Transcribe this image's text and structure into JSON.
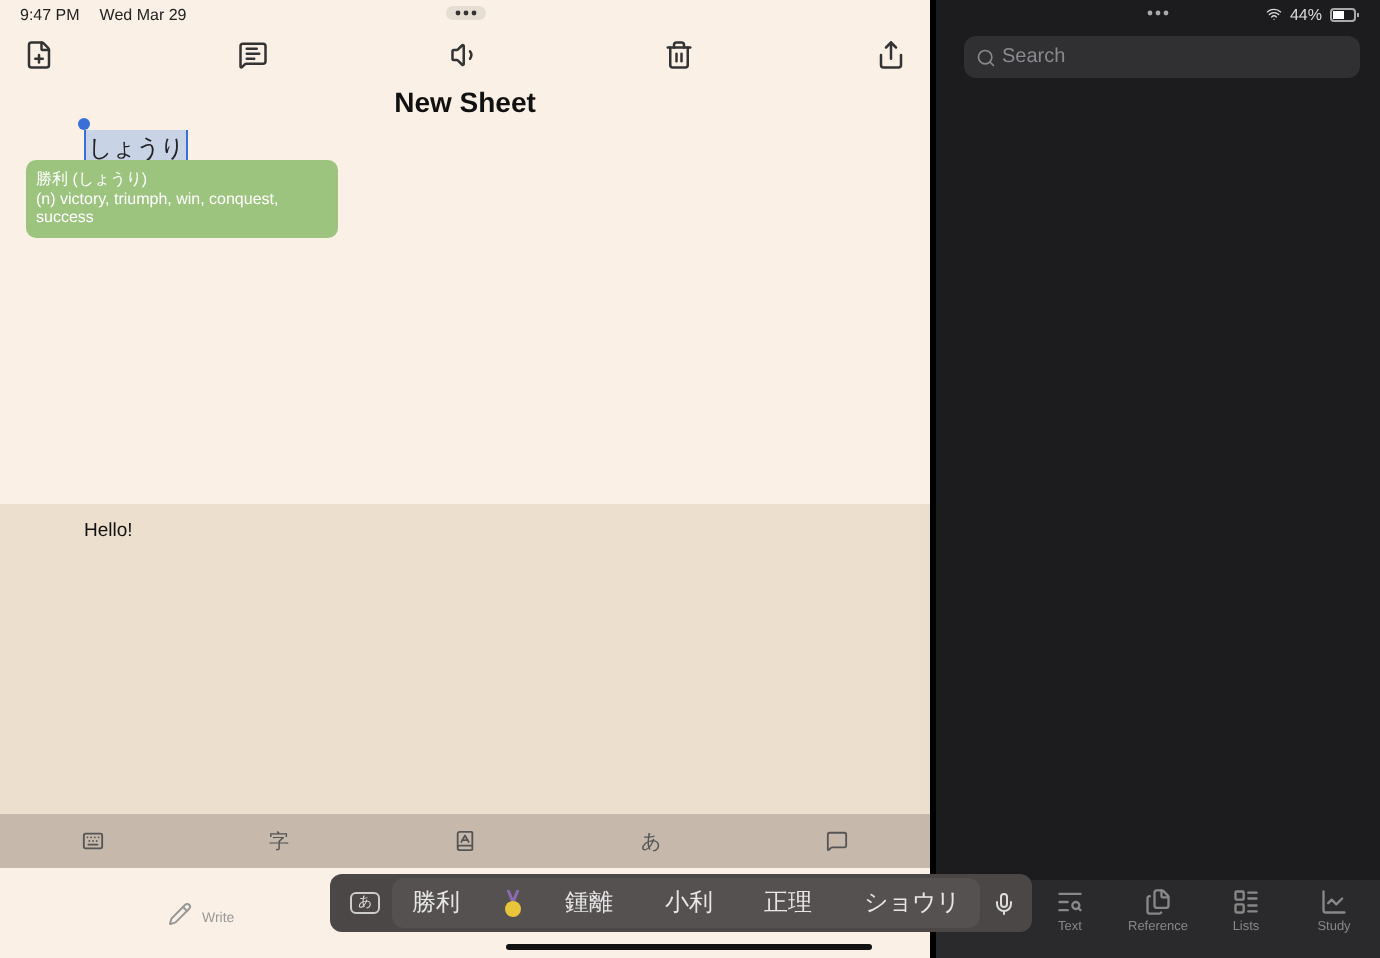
{
  "status_bar": {
    "time": "9:47 PM",
    "date": "Wed Mar 29",
    "battery": "44%"
  },
  "sheet": {
    "title": "New Sheet",
    "selected_text": "しょうり",
    "definition": {
      "headword": "勝利 (しょうり)",
      "gloss": "(n) victory, triumph, win, conquest, success"
    },
    "body": "Hello!"
  },
  "input_strip": [
    {
      "kind": "keyboard"
    },
    {
      "kind": "char",
      "label": "字"
    },
    {
      "kind": "book"
    },
    {
      "kind": "char",
      "label": "あ"
    },
    {
      "kind": "chat"
    }
  ],
  "write_tab": {
    "label": "Write"
  },
  "candidate_bar": {
    "mode": "あ",
    "candidates": [
      {
        "kind": "text",
        "label": "勝利"
      },
      {
        "kind": "medal"
      },
      {
        "kind": "text",
        "label": "鍾離"
      },
      {
        "kind": "text",
        "label": "小利"
      },
      {
        "kind": "text",
        "label": "正理"
      },
      {
        "kind": "text",
        "label": "ショウリ"
      }
    ]
  },
  "search": {
    "placeholder": "Search"
  },
  "tabs": [
    {
      "kind": "text",
      "label": "Text"
    },
    {
      "kind": "reference",
      "label": "Reference"
    },
    {
      "kind": "lists",
      "label": "Lists"
    },
    {
      "kind": "study",
      "label": "Study"
    }
  ]
}
